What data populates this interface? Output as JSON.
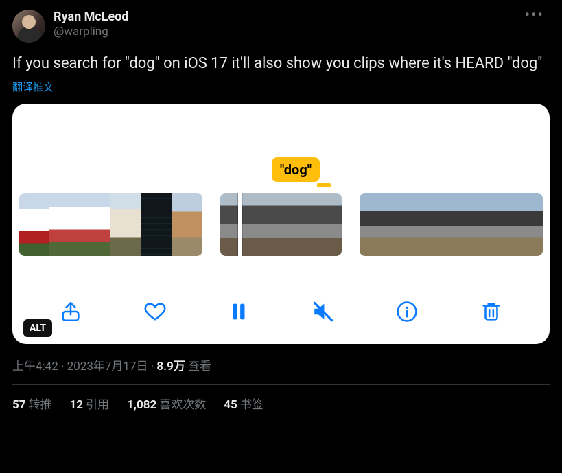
{
  "author": {
    "display_name": "Ryan McLeod",
    "handle": "@warpling"
  },
  "tweet_text": "If you search for \"dog\" on iOS 17 it'll also show you clips where it's HEARD \"dog\"",
  "translate_label": "翻译推文",
  "media": {
    "search_tag": "\"dog\"",
    "alt_badge": "ALT",
    "toolbar": {
      "share": "share",
      "like": "like",
      "pause": "pause",
      "mute": "mute",
      "info": "info",
      "delete": "delete"
    }
  },
  "meta": {
    "time": "上午4:42",
    "separator": " · ",
    "date": "2023年7月17日",
    "views_count": "8.9万",
    "views_label": " 查看"
  },
  "stats": {
    "retweets": {
      "count": "57",
      "label": "转推"
    },
    "quotes": {
      "count": "12",
      "label": "引用"
    },
    "likes": {
      "count": "1,082",
      "label": "喜欢次数"
    },
    "bookmarks": {
      "count": "45",
      "label": "书签"
    }
  }
}
